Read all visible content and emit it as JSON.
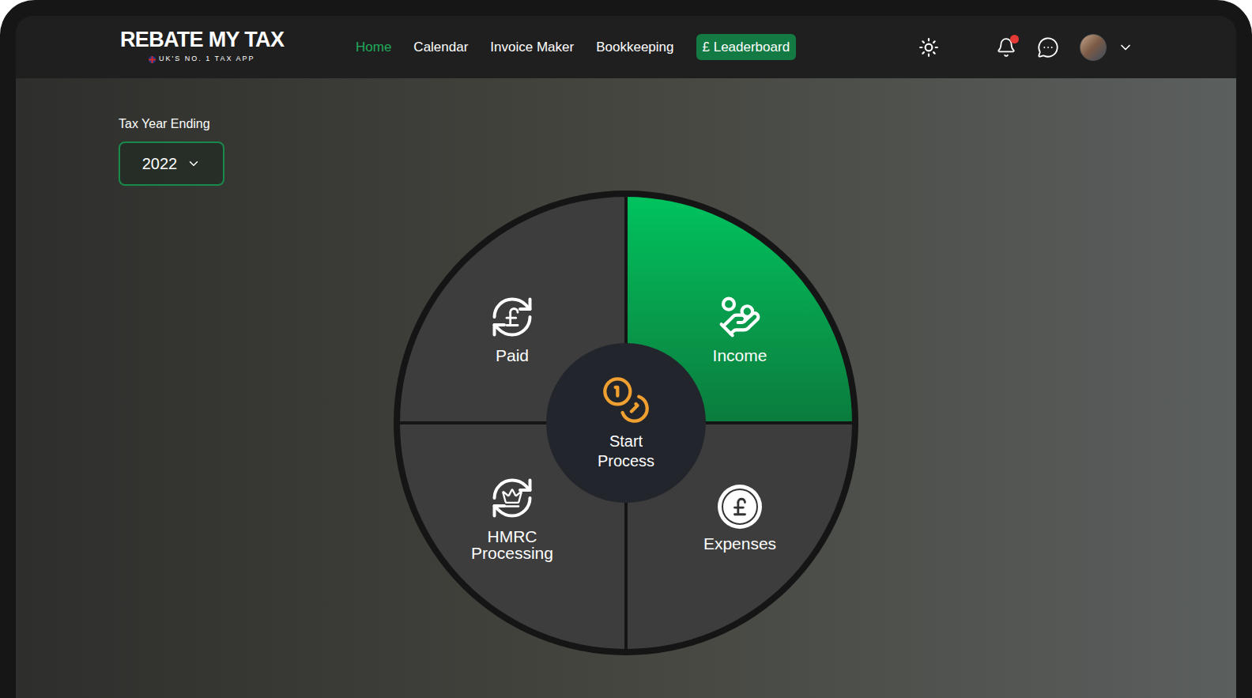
{
  "header": {
    "logo": "REBATE MY TAX",
    "tagline": "UK'S NO. 1 TAX APP",
    "nav": [
      {
        "label": "Home",
        "selected": true,
        "kind": "link"
      },
      {
        "label": "Calendar",
        "selected": false,
        "kind": "link"
      },
      {
        "label": "Invoice Maker",
        "selected": false,
        "kind": "link"
      },
      {
        "label": "Bookkeeping",
        "selected": false,
        "kind": "link"
      },
      {
        "label": "£ Leaderboard",
        "selected": false,
        "kind": "pill"
      }
    ],
    "notifications": {
      "unread": true
    }
  },
  "tax_year": {
    "label": "Tax Year Ending",
    "value": "2022"
  },
  "wheel": {
    "center": "Start Process",
    "segments": [
      {
        "label": "Paid",
        "selected": false
      },
      {
        "label": "Income",
        "selected": true
      },
      {
        "label": "HMRC Processing",
        "selected": false
      },
      {
        "label": "Expenses",
        "selected": false
      }
    ]
  }
}
